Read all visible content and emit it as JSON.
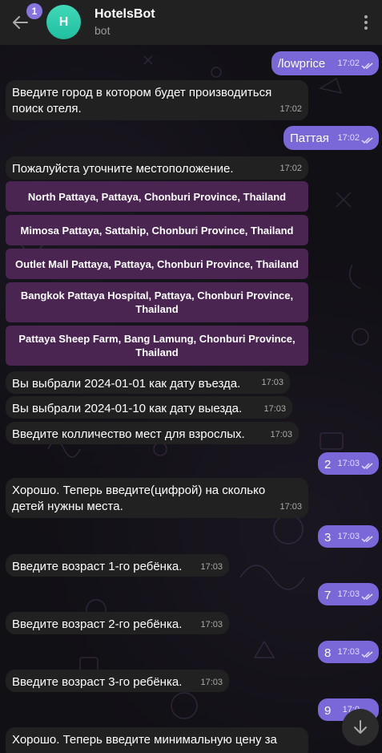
{
  "header": {
    "unread_count": "1",
    "avatar_letter": "H",
    "title": "HotelsBot",
    "status": "bot"
  },
  "messages": [
    {
      "dir": "out",
      "text": "/lowprice",
      "time": "17:02"
    },
    {
      "dir": "in",
      "text": "Введите город в котором будет производиться поиск отеля.",
      "time": "17:02"
    },
    {
      "dir": "out",
      "text": "Паттая",
      "time": "17:02"
    },
    {
      "dir": "in",
      "text": "Пожалуйста уточните местоположение.",
      "time": "17:02"
    },
    {
      "dir": "in",
      "text": "Вы выбрали 2024-01-01 как дату въезда.",
      "time": "17:03"
    },
    {
      "dir": "in",
      "text": "Вы выбрали 2024-01-10 как дату выезда.",
      "time": "17:03"
    },
    {
      "dir": "in",
      "text": "Введите колличество мест для взрослых.",
      "time": "17:03"
    },
    {
      "dir": "out",
      "text": "2",
      "time": "17:03"
    },
    {
      "dir": "in",
      "text": "Хорошо. Теперь введите(цифрой) на сколько детей нужны места.",
      "time": "17:03"
    },
    {
      "dir": "out",
      "text": "3",
      "time": "17:03"
    },
    {
      "dir": "in",
      "text": "Введите возраст 1-го ребёнка.",
      "time": "17:03"
    },
    {
      "dir": "out",
      "text": "7",
      "time": "17:03"
    },
    {
      "dir": "in",
      "text": "Введите возраст 2-го ребёнка.",
      "time": "17:03"
    },
    {
      "dir": "out",
      "text": "8",
      "time": "17:03"
    },
    {
      "dir": "in",
      "text": "Введите возраст 3-го ребёнка.",
      "time": "17:03"
    },
    {
      "dir": "out",
      "text": "9",
      "time": "17:0"
    },
    {
      "dir": "in",
      "text": "Хорошо. Теперь введите минимальную цену за",
      "time": ""
    }
  ],
  "location_buttons": [
    "North Pattaya, Pattaya, Chonburi Province, Thailand",
    "Mimosa Pattaya, Sattahip, Chonburi Province, Thailand",
    "Outlet Mall Pattaya, Pattaya, Chonburi Province, Thailand",
    "Bangkok Pattaya Hospital, Pattaya, Chonburi Province, Thailand",
    "Pattaya Sheep Farm, Bang Lamung, Chonburi Province, Thailand"
  ],
  "icons": {
    "back": "arrow-left-icon",
    "menu": "more-vertical-icon",
    "scroll_down": "arrow-down-icon",
    "read": "double-check-icon"
  },
  "colors": {
    "header_bg": "#212121",
    "incoming_bubble": "#212121",
    "outgoing_bubble": "#7a67d8",
    "keyboard_button": "#4a2551",
    "avatar": "#2fcfae",
    "badge": "#8774e1"
  }
}
